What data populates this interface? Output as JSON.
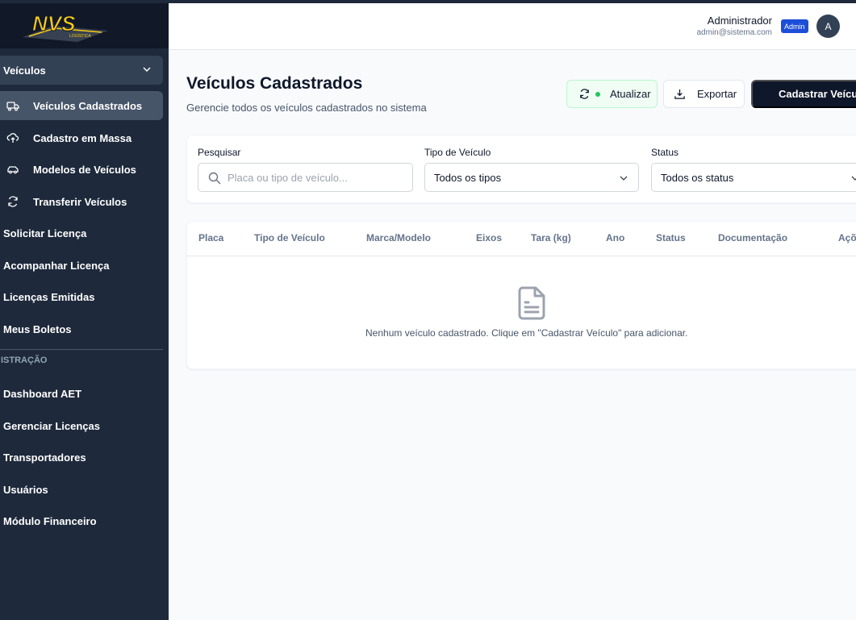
{
  "brand": {
    "logo_text": "NVS",
    "logo_sub": "LOGÍSTICA"
  },
  "sidebar": {
    "group": {
      "label": "Veículos"
    },
    "sub_items": [
      {
        "label": "Veículos Cadastrados",
        "icon": "truck-icon"
      },
      {
        "label": "Cadastro em Massa",
        "icon": "cloud-upload-icon"
      },
      {
        "label": "Modelos de Veículos",
        "icon": "car-icon"
      },
      {
        "label": "Transferir Veículos",
        "icon": "refresh-icon"
      }
    ],
    "items": [
      {
        "label": "Solicitar Licença"
      },
      {
        "label": "Acompanhar Licença"
      },
      {
        "label": "Licenças Emitidas"
      },
      {
        "label": "Meus Boletos"
      }
    ],
    "section_label": "ISTRAÇÃO",
    "admin_items": [
      {
        "label": "Dashboard AET"
      },
      {
        "label": "Gerenciar Licenças"
      },
      {
        "label": "Transportadores"
      },
      {
        "label": "Usuários"
      },
      {
        "label": "Módulo Financeiro"
      }
    ]
  },
  "header": {
    "user_name": "Administrador",
    "user_email": "admin@sistema.com",
    "role_badge": "Admin",
    "avatar_initial": "A"
  },
  "main": {
    "title": "Veículos Cadastrados",
    "subtitle": "Gerencie todos os veículos cadastrados no sistema",
    "buttons": {
      "refresh": "Atualizar",
      "export": "Exportar",
      "new_vehicle": "Cadastrar Veículo"
    },
    "filters": {
      "search_label": "Pesquisar",
      "search_placeholder": "Placa ou tipo de veículo...",
      "type_label": "Tipo de Veículo",
      "type_value": "Todos os tipos",
      "status_label": "Status",
      "status_value": "Todos os status"
    },
    "table": {
      "columns": [
        "Placa",
        "Tipo de Veículo",
        "Marca/Modelo",
        "Eixos",
        "Tara (kg)",
        "Ano",
        "Status",
        "Documentação",
        "Ações"
      ],
      "empty_message": "Nenhum veículo cadastrado. Clique em \"Cadastrar Veículo\" para adicionar."
    }
  },
  "colors": {
    "sidebar_bg": "#1e293b",
    "sidebar_active": "#475569",
    "primary_button": "#0f172a",
    "badge": "#1d4ed8",
    "status_dot": "#22c55e"
  }
}
